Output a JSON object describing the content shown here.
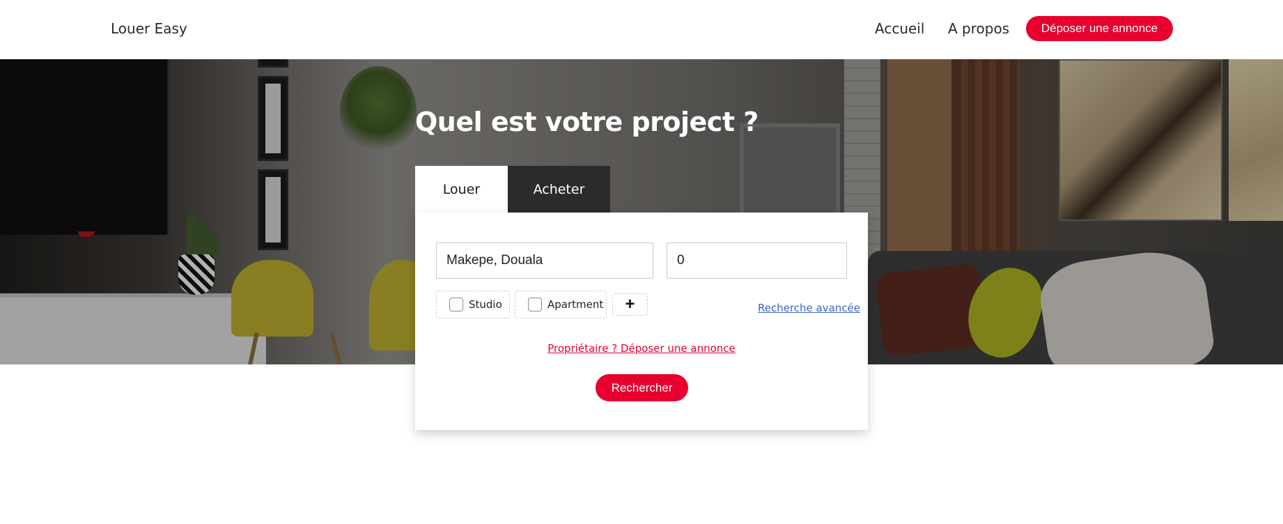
{
  "header": {
    "brand": "Louer Easy",
    "nav": {
      "home": "Accueil",
      "about": "A propos"
    },
    "post_button": "Déposer une annonce"
  },
  "hero": {
    "title": "Quel est votre project ?",
    "tabs": [
      {
        "label": "Louer",
        "active": true
      },
      {
        "label": "Acheter",
        "active": false
      }
    ]
  },
  "search": {
    "location_value": "Makepe, Douala",
    "price_value": "0",
    "property_types": [
      {
        "label": "Studio",
        "checked": false
      },
      {
        "label": "Apartment",
        "checked": false
      }
    ],
    "more_types_symbol": "+",
    "advanced_link": "Recherche avancée",
    "owner_link": "Propriétaire ? Déposer une annonce",
    "submit_label": "Rechercher"
  },
  "colors": {
    "accent": "#e8002f",
    "link": "#3b63c9",
    "tab_inactive": "#2b2b2b"
  }
}
